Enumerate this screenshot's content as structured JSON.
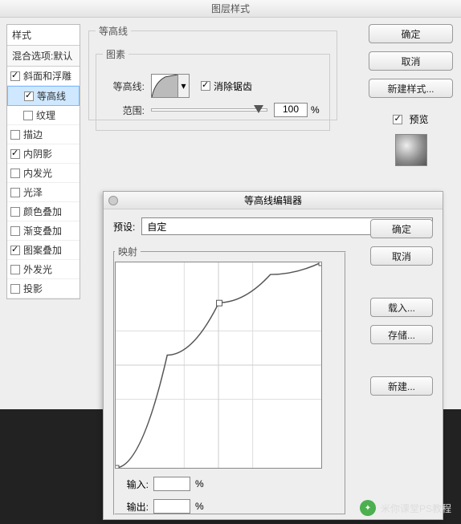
{
  "main": {
    "title": "图层样式",
    "stylesHeader": "样式",
    "blendHeader": "混合选项:默认",
    "items": [
      {
        "label": "斜面和浮雕",
        "checked": true,
        "indent": 0
      },
      {
        "label": "等高线",
        "checked": true,
        "indent": 1,
        "selected": true
      },
      {
        "label": "纹理",
        "checked": false,
        "indent": 1
      },
      {
        "label": "描边",
        "checked": false,
        "indent": 0
      },
      {
        "label": "内阴影",
        "checked": true,
        "indent": 0
      },
      {
        "label": "内发光",
        "checked": false,
        "indent": 0
      },
      {
        "label": "光泽",
        "checked": false,
        "indent": 0
      },
      {
        "label": "颜色叠加",
        "checked": false,
        "indent": 0
      },
      {
        "label": "渐变叠加",
        "checked": false,
        "indent": 0
      },
      {
        "label": "图案叠加",
        "checked": true,
        "indent": 0
      },
      {
        "label": "外发光",
        "checked": false,
        "indent": 0
      },
      {
        "label": "投影",
        "checked": false,
        "indent": 0
      }
    ],
    "contourGroup": "等高线",
    "elementsGroup": "图素",
    "contourLabel": "等高线:",
    "antialias": "消除锯齿",
    "rangeLabel": "范围:",
    "rangeValue": "100",
    "rangeUnit": "%",
    "buttons": {
      "ok": "确定",
      "cancel": "取消",
      "newStyle": "新建样式...",
      "preview": "预览"
    }
  },
  "editor": {
    "title": "等高线编辑器",
    "presetLabel": "预设:",
    "presetValue": "自定",
    "mapping": "映射",
    "inputLabel": "输入:",
    "outputLabel": "输出:",
    "unit": "%",
    "buttons": {
      "ok": "确定",
      "cancel": "取消",
      "load": "载入...",
      "save": "存储...",
      "new": "新建..."
    }
  },
  "chart_data": {
    "type": "line",
    "title": "",
    "xlabel": "输入",
    "ylabel": "输出",
    "xlim": [
      0,
      255
    ],
    "ylim": [
      0,
      255
    ],
    "x": [
      0,
      64,
      128,
      192,
      255
    ],
    "values": [
      0,
      140,
      205,
      240,
      255
    ]
  },
  "watermark": "米你课堂PS教程"
}
